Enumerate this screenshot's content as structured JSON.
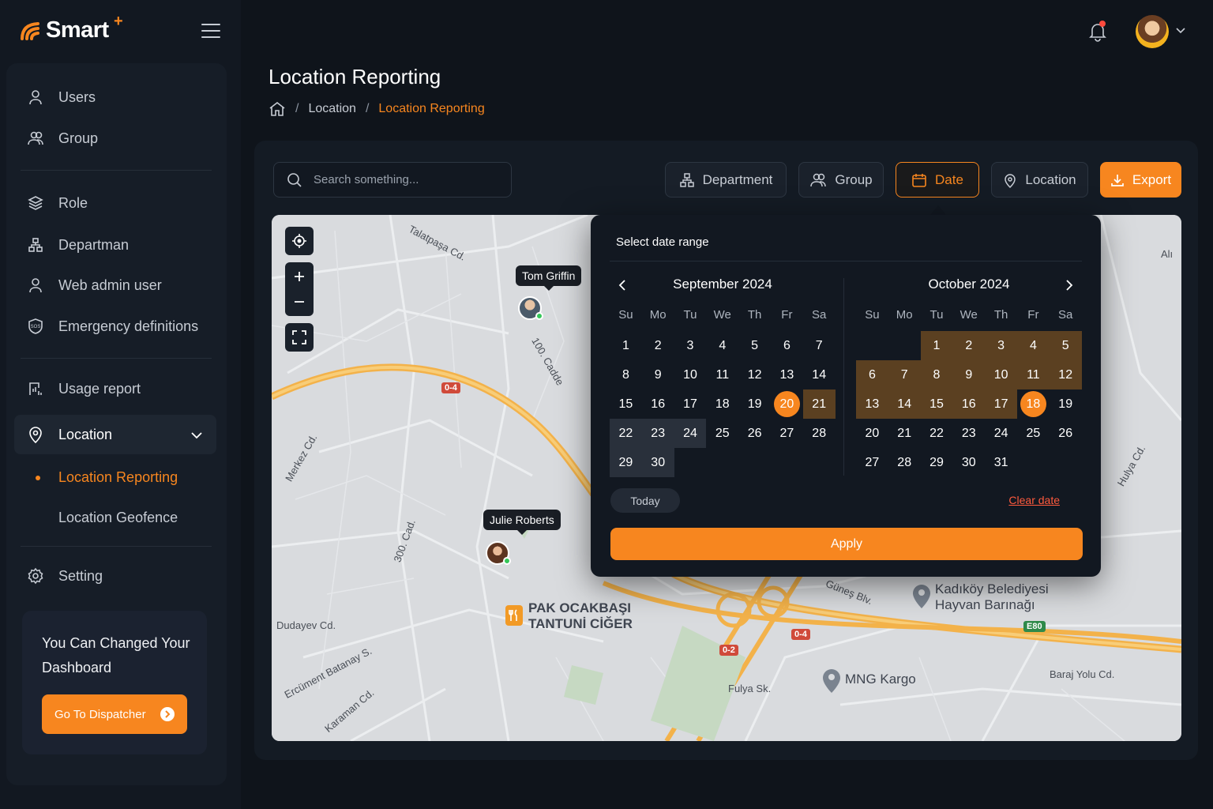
{
  "app": {
    "name": "Smart",
    "name_sup": "+"
  },
  "sidebar": {
    "items": [
      {
        "label": "Users"
      },
      {
        "label": "Group"
      },
      {
        "label": "Role"
      },
      {
        "label": "Departman"
      },
      {
        "label": "Web admin user"
      },
      {
        "label": "Emergency definitions"
      },
      {
        "label": "Usage report"
      },
      {
        "label": "Location"
      },
      {
        "label": "Setting"
      }
    ],
    "sub_items": [
      {
        "label": "Location Reporting"
      },
      {
        "label": "Location Geofence"
      }
    ],
    "promo": {
      "text": "You Can Changed Your Dashboard",
      "button": "Go To Dispatcher"
    }
  },
  "header": {
    "title": "Location Reporting",
    "breadcrumb": {
      "level1": "Location",
      "current": "Location Reporting"
    }
  },
  "toolbar": {
    "search_placeholder": "Search something...",
    "department": "Department",
    "group": "Group",
    "date": "Date",
    "location": "Location",
    "export": "Export"
  },
  "map": {
    "streets": [
      "Talatpaşa Cd.",
      "Alı",
      "Merkez Cd.",
      "300. Cad.",
      "Dudayev Cd.",
      "Ercüment Batanay S.",
      "Karaman Cd.",
      "Fulya Sk.",
      "Baraj Yolu Cd.",
      "Güneş Blv.",
      "100. Cadde",
      "Hulya Cd."
    ],
    "badges": [
      "0-4",
      "0-4",
      "0-2",
      "E80"
    ],
    "places": [
      {
        "name": "PAK OCAKBAŞI TANTUNİ CİĞER"
      },
      {
        "name": "Kadıköy Belediyesi Hayvan Barınağı"
      },
      {
        "name": "MNG Kargo"
      }
    ],
    "people": [
      {
        "name": "Tom Griffin"
      },
      {
        "name": "Julie Roberts"
      }
    ]
  },
  "date_picker": {
    "title": "Select date range",
    "left_month": "September 2024",
    "right_month": "October 2024",
    "weekdays": [
      "Su",
      "Mo",
      "Tu",
      "We",
      "Th",
      "Fr",
      "Sa"
    ],
    "left": {
      "first_weekday": 0,
      "days": 30,
      "selected": 20
    },
    "right": {
      "first_weekday": 2,
      "days": 31,
      "selected": 18
    },
    "today": "Today",
    "clear": "Clear date",
    "apply": "Apply"
  },
  "colors": {
    "accent": "#f7861f",
    "bg": "#0f141b",
    "panel": "#161d27",
    "range": "#5b4021"
  }
}
